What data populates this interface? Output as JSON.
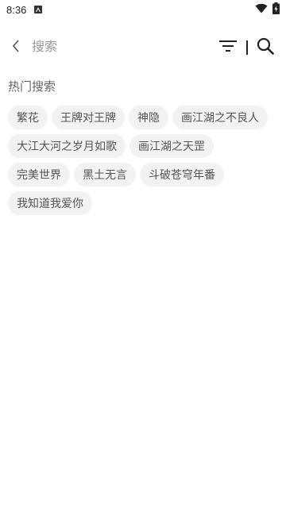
{
  "status_bar": {
    "time": "8:36"
  },
  "search": {
    "placeholder": "搜索",
    "value": ""
  },
  "hot_search": {
    "title": "热门搜索",
    "tags": [
      "繁花",
      "王牌对王牌",
      "神隐",
      "画江湖之不良人",
      "大江大河之岁月如歌",
      "画江湖之天罡",
      "完美世界",
      "黑土无言",
      "斗破苍穹年番",
      "我知道我爱你"
    ]
  },
  "colors": {
    "background": "#ffffff",
    "tag_background": "#f2f2f2",
    "text": "#555555",
    "placeholder": "#999999"
  }
}
